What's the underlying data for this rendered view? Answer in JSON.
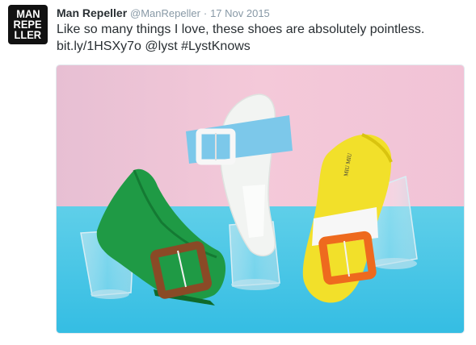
{
  "tweet": {
    "avatar_lines": [
      "MAN",
      "REPE",
      "LLER"
    ],
    "display_name": "Man Repeller",
    "handle": "@ManRepeller",
    "separator": "·",
    "date": "17 Nov 2015",
    "text_line1": "Like so many things I love, these shoes are absolutely pointless.",
    "link": "bit.ly/1HSXy7o",
    "mention": "@lyst",
    "hashtag": "#LystKnows",
    "media": {
      "shoe_label": "MIU MIU",
      "colors": {
        "backdrop": "#f0c8d8",
        "surface": "#4fc8e8",
        "green_shoe": "#1f9a45",
        "white_shoe": "#f2f4f2",
        "yellow_shoe": "#f2e02a",
        "blue_buckle": "#7cc8ea",
        "brown_buckle": "#8a4a26",
        "orange_buckle": "#ee6a1e"
      }
    }
  }
}
